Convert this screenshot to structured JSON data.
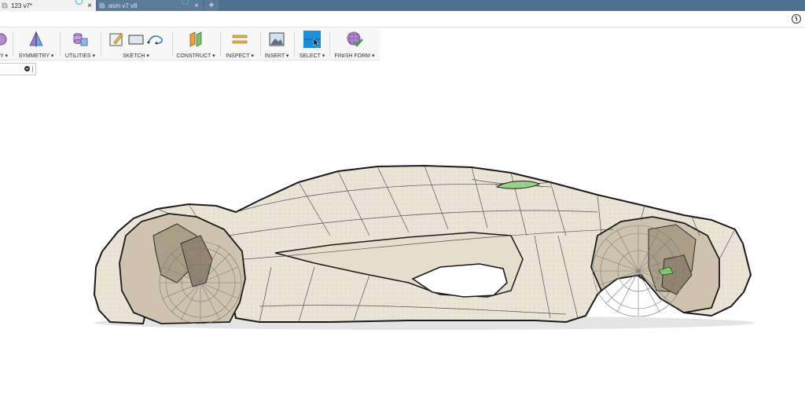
{
  "tabs": [
    {
      "label": "123 v7*",
      "active": true
    },
    {
      "label": "asm v7 v8",
      "active": false
    }
  ],
  "new_tab_label": "+",
  "close_glyph": "×",
  "toolbar": {
    "groups": [
      {
        "label": "Y ▾",
        "icons": [
          "modify-icon"
        ]
      },
      {
        "label": "SYMMETRY ▾",
        "icons": [
          "symmetry-icon"
        ]
      },
      {
        "label": "UTILITIES ▾",
        "icons": [
          "utilities-icon"
        ]
      },
      {
        "label": "SKETCH ▾",
        "icons": [
          "sketch-edit-icon",
          "rectangle-icon",
          "spline-icon"
        ]
      },
      {
        "label": "CONSTRUCT ▾",
        "icons": [
          "construct-plane-icon"
        ]
      },
      {
        "label": "INSPECT ▾",
        "icons": [
          "inspect-measure-icon"
        ]
      },
      {
        "label": "INSERT ▾",
        "icons": [
          "insert-image-icon"
        ]
      },
      {
        "label": "SELECT ▾",
        "icons": [
          "select-cursor-icon"
        ]
      },
      {
        "label": "FINISH FORM ▾",
        "icons": [
          "finish-form-icon"
        ]
      }
    ]
  },
  "colors": {
    "tabbar": "#4f6f8e",
    "select_active": "#1b8fd6",
    "car_surface": "#e9e1d2",
    "car_outline": "#1a1a1a"
  },
  "viewport": {
    "model": "car-t-spline-body"
  }
}
